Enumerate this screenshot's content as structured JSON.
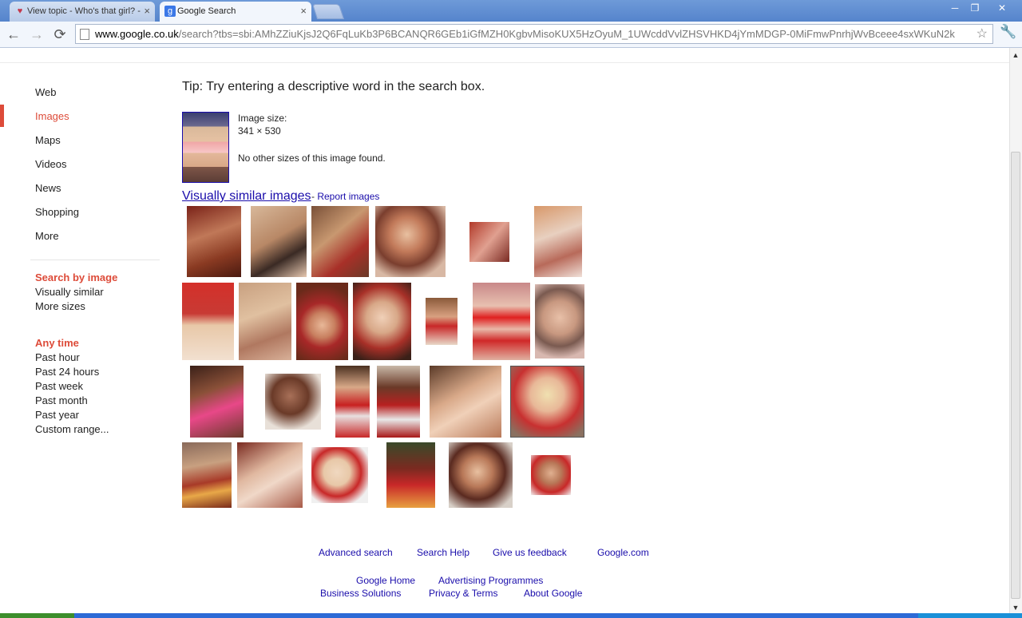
{
  "browser": {
    "tabs": [
      {
        "title": "View topic - Who's that girl? -",
        "active": false,
        "icon": "heart-favicon"
      },
      {
        "title": "Google Search",
        "active": true,
        "icon": "google-favicon"
      }
    ],
    "url_host": "www.google.co.uk",
    "url_path": "/search?tbs=sbi:AMhZZiuKjsJ2Q6FqLuKb3P6BCANQR6GEb1iGfMZH0KgbvMisoKUX5HzOyuM_1UWcddVvlZHSVHKD4jYmMDGP-0MiFmwPnrhjWvBceee4sxWKuN2k",
    "win_min": "─",
    "win_max": "❐",
    "win_close": "✕",
    "back": "←",
    "forward": "→",
    "reload": "⟳",
    "star": "☆",
    "wrench": "🔧"
  },
  "nav": {
    "items": [
      {
        "label": "Web",
        "selected": false
      },
      {
        "label": "Images",
        "selected": true
      },
      {
        "label": "Maps",
        "selected": false
      },
      {
        "label": "Videos",
        "selected": false
      },
      {
        "label": "News",
        "selected": false
      },
      {
        "label": "Shopping",
        "selected": false
      },
      {
        "label": "More",
        "selected": false
      }
    ]
  },
  "search_by_image": {
    "heading": "Search by image",
    "items": [
      "Visually similar",
      "More sizes"
    ]
  },
  "time_filter": {
    "heading": "Any time",
    "items": [
      "Past hour",
      "Past 24 hours",
      "Past week",
      "Past month",
      "Past year",
      "Custom range..."
    ]
  },
  "main": {
    "tip": "Tip: Try entering a descriptive word in the search box.",
    "image_size_label": "Image size:",
    "image_size_value": "341 × 530",
    "no_other_sizes": "No other sizes of this image found.",
    "similar_link": "Visually similar images",
    "report_sep": " - ",
    "report_link": "Report images"
  },
  "footer": {
    "row1": [
      "Advanced search",
      "Search Help",
      "Give us feedback",
      "Google.com"
    ],
    "row2": [
      "Google Home",
      "Advertising Programmes"
    ],
    "row3": [
      "Business Solutions",
      "Privacy & Terms",
      "About Google"
    ]
  },
  "colors": {
    "accent_red": "#dd4b39",
    "link_blue": "#1a0dab",
    "chrome_blue": "#5584cc"
  }
}
